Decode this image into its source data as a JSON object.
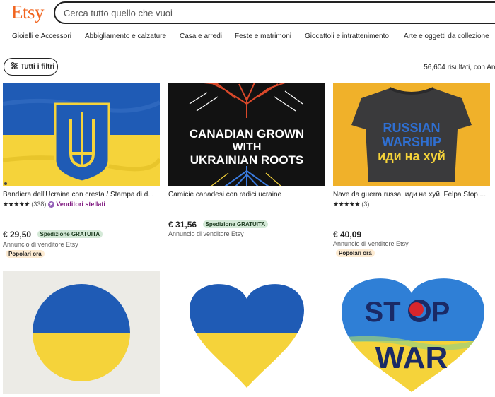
{
  "header": {
    "logo": "Etsy",
    "search_placeholder": "Cerca tutto quello che vuoi"
  },
  "nav": {
    "items": [
      "Gioielli e Accessori",
      "Abbigliamento e calzature",
      "Casa e arredi",
      "Feste e matrimoni",
      "Giocattoli e intrattenimento",
      "Arte e oggetti da collezione"
    ]
  },
  "toolbar": {
    "filters_label": "Tutti i filtri",
    "results_text": "56,604 risultati, con Ann"
  },
  "listings": [
    {
      "title": "Bandiera dell'Ucraina con cresta / Stampa di d...",
      "stars": "★★★★★",
      "reviews": "(338)",
      "star_seller": "Venditori stellati",
      "price": "€ 29,50",
      "shipping": "Spedizione GRATUITA",
      "seller": "Annuncio di venditore Etsy",
      "badge": "Popolari ora"
    },
    {
      "title": "Camicie canadesi con radici ucraine",
      "image_text": [
        "CANADIAN GROWN",
        "WITH",
        "UKRAINIAN ROOTS"
      ],
      "price": "€ 31,56",
      "shipping": "Spedizione GRATUITA",
      "seller": "Annuncio di venditore Etsy"
    },
    {
      "title": "Nave da guerra russa, иди на хуй, Felpa Stop ...",
      "image_text": [
        "RUSSIAN",
        "WARSHIP",
        "иди на хуй"
      ],
      "stars": "★★★★★",
      "reviews": "(3)",
      "price": "€ 40,09",
      "seller": "Annuncio di venditore Etsy",
      "badge": "Popolari ora"
    },
    {},
    {},
    {
      "image_text": [
        "ST",
        "P",
        "WAR"
      ]
    }
  ],
  "colors": {
    "brand": "#f1641e",
    "ukraine_blue": "#1f5bb5",
    "ukraine_yellow": "#f5d33a",
    "free_shipping_bg": "#d4e9d7",
    "popular_badge_bg": "#fdebd2"
  }
}
